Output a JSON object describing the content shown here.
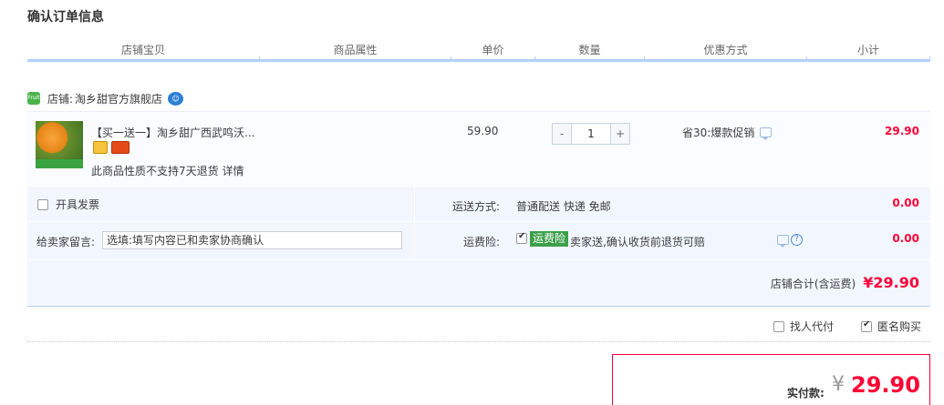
{
  "page_title": "确认订单信息",
  "table_headers": [
    "店铺宝贝",
    "商品属性",
    "单价",
    "数量",
    "优惠方式",
    "小计"
  ],
  "shop": {
    "logo_text": "Fruit",
    "label": "店铺:",
    "name": "淘乡甜官方旗舰店"
  },
  "item": {
    "title": "【买一送一】淘乡甜广西武鸣沃...",
    "notice": "此商品性质不支持7天退货 详情",
    "unit_price": "59.90",
    "quantity": "1",
    "qty_minus": "-",
    "qty_plus": "+",
    "promo": "省30:爆款促销",
    "subtotal": "29.90"
  },
  "options": {
    "invoice_label": "开具发票",
    "shipping_label": "运送方式:",
    "shipping_value": "普通配送 快递 免邮",
    "shipping_price": "0.00",
    "message_label": "给卖家留言:",
    "message_placeholder": "选填:填写内容已和卖家协商确认",
    "insurance_label": "运费险:",
    "insurance_tag": "运费险",
    "insurance_desc": "卖家送,确认收货前退货可赔",
    "insurance_price": "0.00",
    "help_symbol": "?"
  },
  "shop_total": {
    "label": "店铺合计(含运费)",
    "value": "¥29.90"
  },
  "extra": {
    "proxy_label": "找人代付",
    "anon_label": "匿名购买"
  },
  "payment": {
    "label": "实付款:",
    "currency": "¥",
    "amount": "29.90"
  },
  "colors": {
    "accent_red": "#ff0036",
    "header_blue": "#b2d1ff",
    "option_bg": "#f2f7ff",
    "insurance_green": "#3ca04a"
  }
}
